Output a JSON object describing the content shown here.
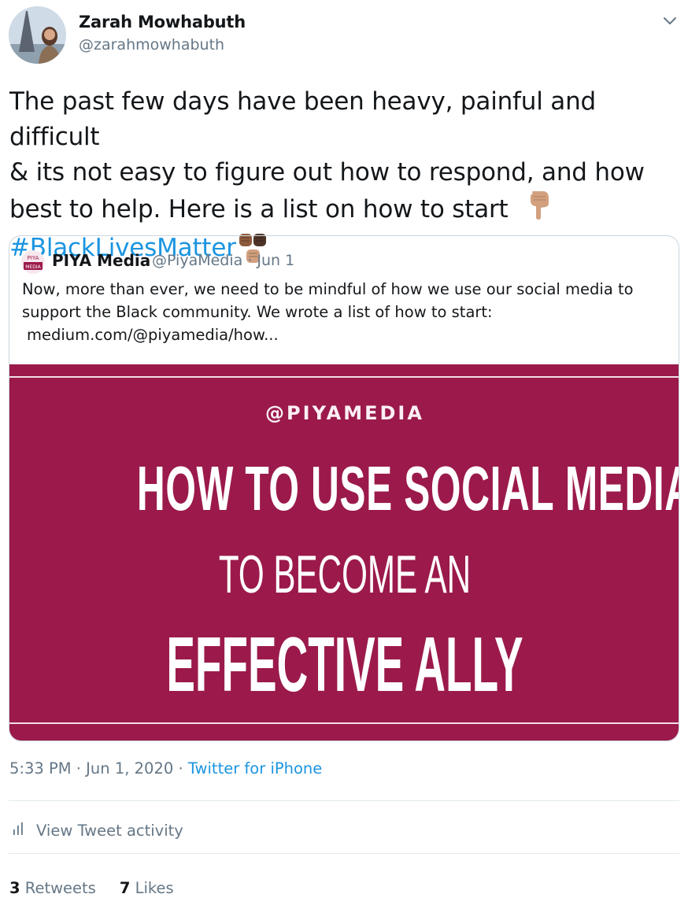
{
  "author": {
    "name": "Zarah Mowhabuth",
    "handle": "@zarahmowhabuth"
  },
  "tweet": {
    "text_line1": "The past few days have been heavy, painful and difficult",
    "text_line2": "& its not easy to figure out how to respond, and how",
    "text_line3": "best to help. Here is a list on how to start",
    "hashtag": "#BlackLivesMatter",
    "emoji_point": "backhand-index-pointing-down",
    "emoji_fists": "raised-fists"
  },
  "quote": {
    "name": "PIYA Media",
    "handle": "@PiyaMedia",
    "date": "· Jun 1",
    "text": "Now, more than ever, we need to be mindful of how we use our social media to support the Black community. We wrote a list of how to start:",
    "link": "medium.com/@piyamedia/how...",
    "image": {
      "handle": "@PIYAMEDIA",
      "line1": "HOW TO USE SOCIAL MEDIA",
      "line2": "TO BECOME AN",
      "line3": "EFFECTIVE ALLY",
      "bg_color": "#9b1a4b"
    }
  },
  "meta": {
    "time": "5:33 PM",
    "date": " · Jun 1, 2020 · ",
    "source": "Twitter for iPhone"
  },
  "activity": {
    "label": "View Tweet activity"
  },
  "stats": {
    "retweets_count": "3",
    "retweets_label": "Retweets",
    "likes_count": "7",
    "likes_label": "Likes"
  },
  "colors": {
    "link": "#1b95e0",
    "secondary": "#657786",
    "border": "#ccd6dd"
  }
}
